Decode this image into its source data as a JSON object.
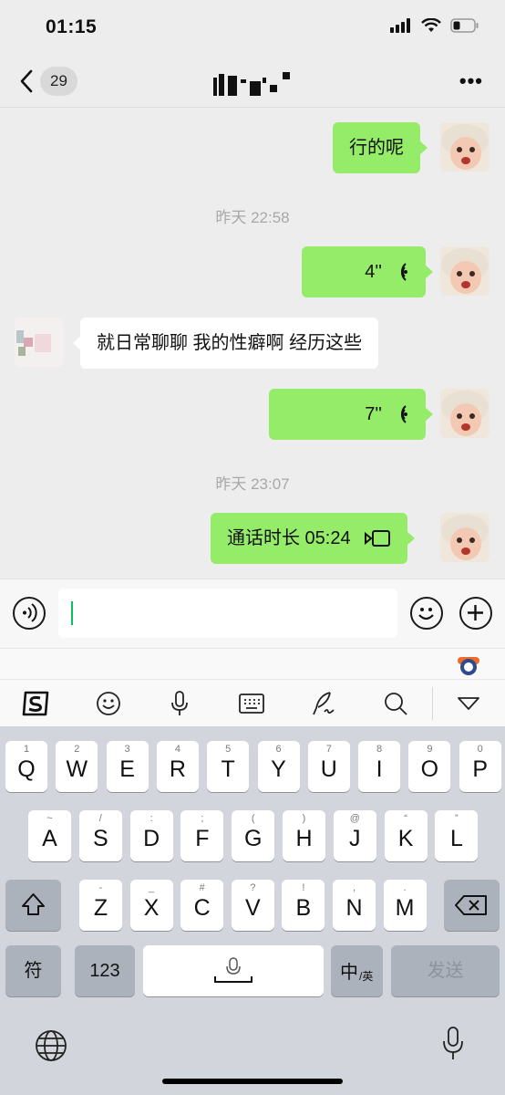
{
  "status_bar": {
    "time": "01:15"
  },
  "nav": {
    "unread_count": "29"
  },
  "messages": [
    {
      "side": "me",
      "type": "text",
      "text": "行的呢"
    },
    {
      "type": "timestamp",
      "text": "昨天 22:58"
    },
    {
      "side": "me",
      "type": "voice",
      "duration": "4''"
    },
    {
      "side": "them",
      "type": "text",
      "text": "就日常聊聊 我的性癖啊 经历这些"
    },
    {
      "side": "me",
      "type": "voice",
      "duration": "7''"
    },
    {
      "type": "timestamp",
      "text": "昨天 23:07"
    },
    {
      "side": "me",
      "type": "call",
      "text": "通话时长 05:24"
    }
  ],
  "keyboard": {
    "row1": [
      {
        "k": "Q",
        "h": "1"
      },
      {
        "k": "W",
        "h": "2"
      },
      {
        "k": "E",
        "h": "3"
      },
      {
        "k": "R",
        "h": "4"
      },
      {
        "k": "T",
        "h": "5"
      },
      {
        "k": "Y",
        "h": "6"
      },
      {
        "k": "U",
        "h": "7"
      },
      {
        "k": "I",
        "h": "8"
      },
      {
        "k": "O",
        "h": "9"
      },
      {
        "k": "P",
        "h": "0"
      }
    ],
    "row2": [
      {
        "k": "A",
        "h": "~"
      },
      {
        "k": "S",
        "h": "/"
      },
      {
        "k": "D",
        "h": ":"
      },
      {
        "k": "F",
        "h": ";"
      },
      {
        "k": "G",
        "h": "("
      },
      {
        "k": "H",
        "h": ")"
      },
      {
        "k": "J",
        "h": "@"
      },
      {
        "k": "K",
        "h": "“"
      },
      {
        "k": "L",
        "h": "”"
      }
    ],
    "row3": [
      {
        "k": "Z",
        "h": "-"
      },
      {
        "k": "X",
        "h": "_"
      },
      {
        "k": "C",
        "h": "#"
      },
      {
        "k": "V",
        "h": "?"
      },
      {
        "k": "B",
        "h": "!"
      },
      {
        "k": "N",
        "h": ","
      },
      {
        "k": "M",
        "h": "."
      }
    ],
    "symbol_label": "符",
    "number_label": "123",
    "lang_label": "中",
    "lang_sub_label": "/英",
    "send_label": "发送"
  },
  "colors": {
    "my_bubble": "#95ec69",
    "their_bubble": "#ffffff",
    "background": "#ededed",
    "caret": "#07c160"
  },
  "icons": [
    "back-icon",
    "more-icon",
    "voice-toggle-icon",
    "emoji-icon",
    "plus-icon",
    "sogou-icon",
    "mic-icon",
    "keyboard-icon",
    "handwriting-icon",
    "search-icon",
    "collapse-icon",
    "shift-icon",
    "backspace-icon",
    "globe-icon"
  ]
}
